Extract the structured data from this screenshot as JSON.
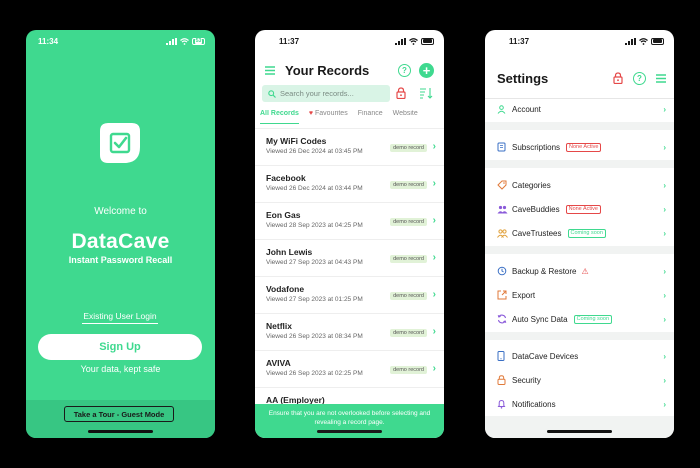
{
  "colors": {
    "accent": "#3fd98f",
    "accent_dark": "#37c683",
    "danger": "#e54848",
    "tint": "#d9f4e6"
  },
  "welcome_screen": {
    "time": "11:34",
    "battery": "53",
    "welcome": "Welcome to",
    "brand": "DataCave",
    "tagline": "Instant Password Recall",
    "existing_login": "Existing User Login",
    "signup": "Sign Up",
    "kept_safe": "Your data, kept safe",
    "guest_tour": "Take a Tour - Guest Mode"
  },
  "records_screen": {
    "time": "11:37",
    "title": "Your Records",
    "search_placeholder": "Search your records...",
    "tabs": [
      "All Records",
      "Favourites",
      "Finance",
      "Website"
    ],
    "badge": "demo record",
    "records": [
      {
        "name": "My WiFi Codes",
        "viewed": "Viewed 26 Dec 2024 at 03:45 PM"
      },
      {
        "name": "Facebook",
        "viewed": "Viewed 26 Dec 2024 at 03:44 PM"
      },
      {
        "name": "Eon Gas",
        "viewed": "Viewed 28 Sep 2023 at 04:25 PM"
      },
      {
        "name": "John Lewis",
        "viewed": "Viewed 27 Sep 2023 at 04:43 PM"
      },
      {
        "name": "Vodafone",
        "viewed": "Viewed 27 Sep 2023 at 01:25 PM"
      },
      {
        "name": "Netflix",
        "viewed": "Viewed 26 Sep 2023 at 08:34 PM"
      },
      {
        "name": "AVIVA",
        "viewed": "Viewed 26 Sep 2023 at 02:25 PM"
      },
      {
        "name": "AA (Employer)",
        "viewed": ""
      }
    ],
    "footer": "Ensure that you are not overlooked before selecting and revealing a record page."
  },
  "settings_screen": {
    "time": "11:37",
    "title": "Settings",
    "items": {
      "account": "Account",
      "subscriptions": "Subscriptions",
      "subscriptions_pill": "None Active",
      "categories": "Categories",
      "cavebuddies": "CaveBuddies",
      "cavebuddies_pill": "None Active",
      "cavetrustees": "CaveTrustees",
      "cavetrustees_pill": "Coming soon",
      "backup": "Backup & Restore",
      "export": "Export",
      "autosync": "Auto Sync Data",
      "autosync_pill": "Coming soon",
      "devices": "DataCave Devices",
      "security": "Security",
      "notifications": "Notifications"
    }
  }
}
